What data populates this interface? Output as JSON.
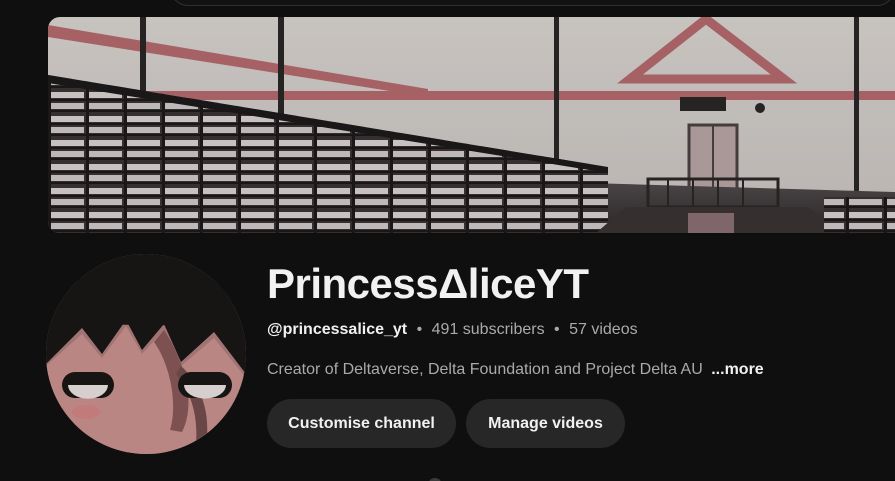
{
  "channel": {
    "name": "PrincessΔliceYT",
    "handle": "@princessalice_yt",
    "subscribers": "491 subscribers",
    "videos": "57 videos",
    "separator": "•",
    "description": "Creator of Deltaverse, Delta Foundation and Project Delta AU",
    "more_label": "...more"
  },
  "actions": {
    "customise_label": "Customise channel",
    "manage_label": "Manage videos"
  },
  "colors": {
    "background": "#0f0f0f",
    "button_bg": "#272727",
    "text_primary": "#f1f1f1",
    "text_secondary": "#aaaaaa",
    "banner_accent": "#b56a6e"
  }
}
